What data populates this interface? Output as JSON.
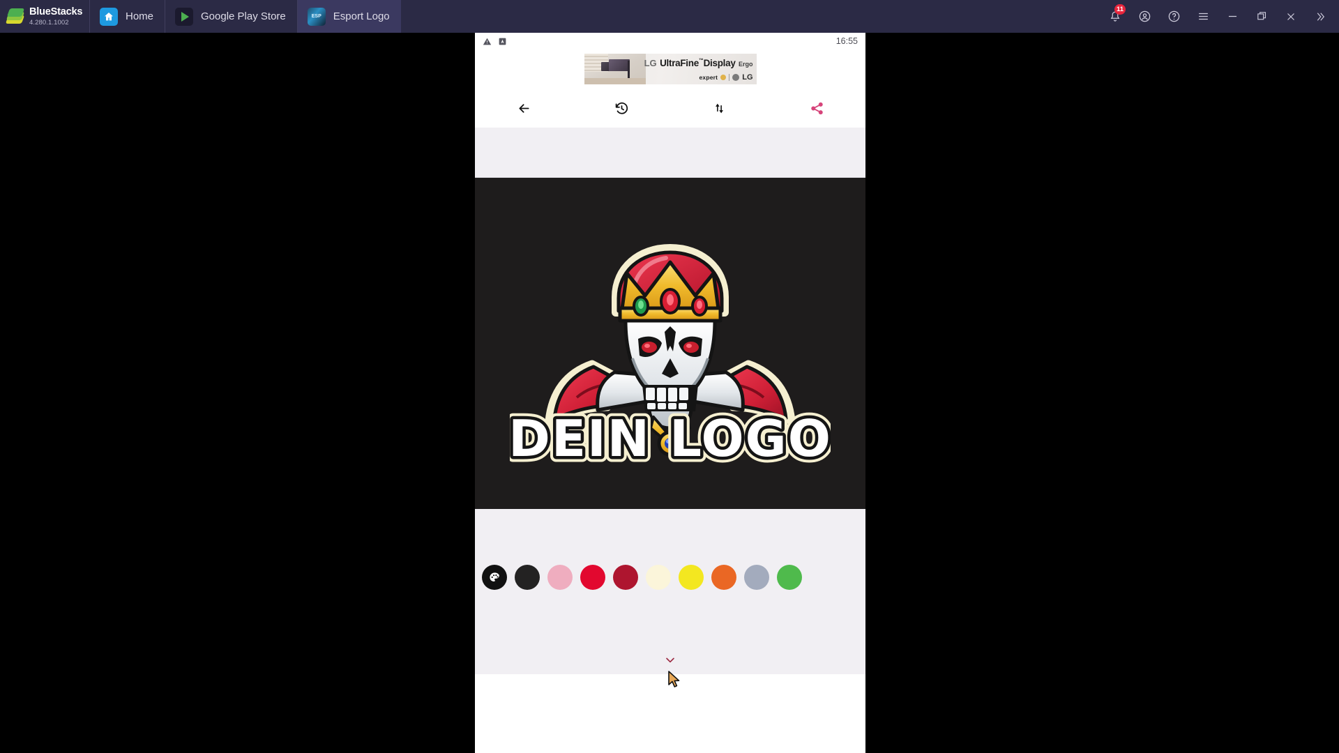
{
  "titlebar": {
    "brand": "BlueStacks",
    "version": "4.280.1.1002",
    "tabs": [
      {
        "label": "Home",
        "icon": "home-icon",
        "active": false
      },
      {
        "label": "Google Play Store",
        "icon": "play-store-icon",
        "active": false
      },
      {
        "label": "Esport Logo",
        "icon": "esport-logo-icon",
        "active": true
      }
    ],
    "controls": [
      {
        "name": "notifications-bell-icon",
        "badge": "11"
      },
      {
        "name": "account-icon",
        "badge": ""
      },
      {
        "name": "help-icon",
        "badge": ""
      },
      {
        "name": "menu-icon",
        "badge": ""
      },
      {
        "name": "minimize-icon",
        "badge": ""
      },
      {
        "name": "maximize-icon",
        "badge": ""
      },
      {
        "name": "close-icon",
        "badge": ""
      },
      {
        "name": "expand-chevrons-icon",
        "badge": ""
      }
    ],
    "background": "#2b2a45",
    "active_tab_background": "#3b3960"
  },
  "phone": {
    "status_bar": {
      "time": "16:55",
      "icons": [
        "warning-triangle-icon",
        "app-notification-icon"
      ]
    },
    "ad": {
      "brand": "LG",
      "product": "UltraFine",
      "product2": "Display",
      "variant": "Ergo",
      "retailer": "expert",
      "brand2": "LG"
    },
    "toolbar": [
      {
        "name": "back-button",
        "icon": "arrow-left-icon",
        "color": "#111111"
      },
      {
        "name": "history-button",
        "icon": "history-clock-icon",
        "color": "#111111"
      },
      {
        "name": "reorder-button",
        "icon": "sort-updown-icon",
        "color": "#111111"
      },
      {
        "name": "share-button",
        "icon": "share-icon",
        "color": "#d6447a"
      }
    ],
    "canvas": {
      "background": "#1e1c1c",
      "logo_text": "DEIN LOGO",
      "mascot": "skull-king-mascot",
      "crown_color": "#f2c12e",
      "cape_color": "#d92a40",
      "skull_color": "#e8eaec",
      "eye_color": "#c81f2e",
      "outline_color": "#f5efd0"
    },
    "color_picker": {
      "swatches": [
        {
          "name": "color-palette-button",
          "color": "#111111",
          "type": "palette"
        },
        {
          "name": "swatch-black",
          "color": "#232222",
          "type": "color"
        },
        {
          "name": "swatch-pink",
          "color": "#efadbf",
          "type": "color"
        },
        {
          "name": "swatch-red",
          "color": "#e2082f",
          "type": "color"
        },
        {
          "name": "swatch-dark-red",
          "color": "#ae152f",
          "type": "color"
        },
        {
          "name": "swatch-cream",
          "color": "#fbf5da",
          "type": "color"
        },
        {
          "name": "swatch-yellow",
          "color": "#f3e720",
          "type": "color"
        },
        {
          "name": "swatch-orange",
          "color": "#ea6724",
          "type": "color"
        },
        {
          "name": "swatch-blue-gray",
          "color": "#a3abbd",
          "type": "color"
        },
        {
          "name": "swatch-green",
          "color": "#4fba4c",
          "type": "color"
        }
      ],
      "collapse_icon": "chevron-down-icon",
      "collapse_color": "#9d2b43"
    },
    "panel_background": "#f1eff3"
  },
  "desktop": {
    "background": "#000000"
  }
}
